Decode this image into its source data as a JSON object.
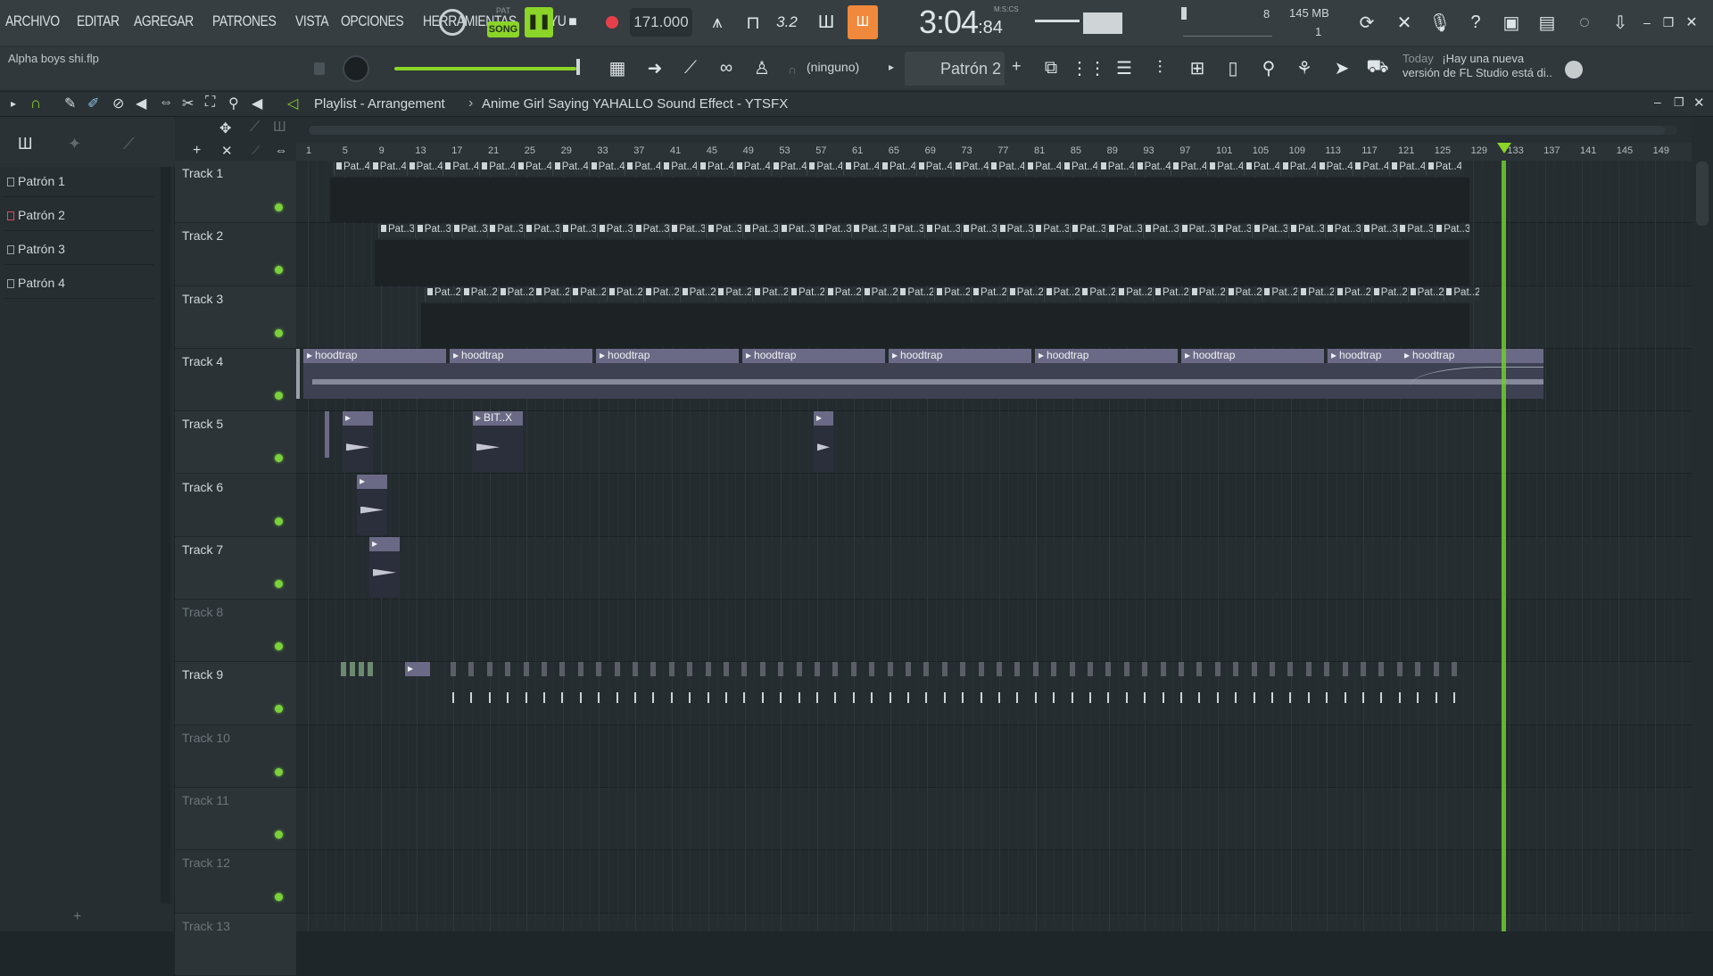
{
  "menu": [
    "ARCHIVO",
    "EDITAR",
    "AGREGAR",
    "PATRONES",
    "VISTA",
    "OPCIONES",
    "HERRAMIENTAS",
    "AYU"
  ],
  "transport": {
    "pat_label": "PAT",
    "song_label": "SONG",
    "tempo": "171.000",
    "time": "3:04",
    "time_small": ":84",
    "time_unit": "M:S:CS",
    "step": "3.2"
  },
  "cpu": {
    "voices": "8",
    "memory": "145 MB",
    "count": "1"
  },
  "project_file": "Alpha boys shi.flp",
  "channel_select": "(ninguno)",
  "pattern_select": "Patrón 2",
  "news": {
    "date": "Today",
    "line1": "¡Hay una nueva",
    "line2": "versión de FL Studio está di.."
  },
  "playlist": {
    "title": "Playlist - Arrangement",
    "sep": "›",
    "sample": "Anime Girl Saying YAHALLO Sound Effect - YTSFX"
  },
  "patterns": [
    "Patrón 1",
    "Patrón 2",
    "Patrón 3",
    "Patrón 4"
  ],
  "tracks": [
    "Track 1",
    "Track 2",
    "Track 3",
    "Track 4",
    "Track 5",
    "Track 6",
    "Track 7",
    "Track 8",
    "Track 9",
    "Track 10",
    "Track 11",
    "Track 12",
    "Track 13"
  ],
  "ruler": [
    "1",
    "5",
    "9",
    "13",
    "17",
    "21",
    "25",
    "29",
    "33",
    "37",
    "41",
    "45",
    "49",
    "53",
    "57",
    "61",
    "65",
    "69",
    "73",
    "77",
    "81",
    "85",
    "89",
    "93",
    "97",
    "101",
    "105",
    "109",
    "113",
    "117",
    "121",
    "125",
    "129",
    "133",
    "137",
    "141",
    "145",
    "149"
  ],
  "clips": {
    "pat4": "Pat..4",
    "pat3": "Pat..3",
    "pat2": "Pat..2",
    "hood": "hoodtrap",
    "bitx": "BIT..X"
  },
  "colors": {
    "accent": "#7ad13a",
    "playhead": "#6fcf2f",
    "song_btn": "#8bd428",
    "loop_btn": "#f0893b",
    "audio_clip": "#6b6a86"
  }
}
